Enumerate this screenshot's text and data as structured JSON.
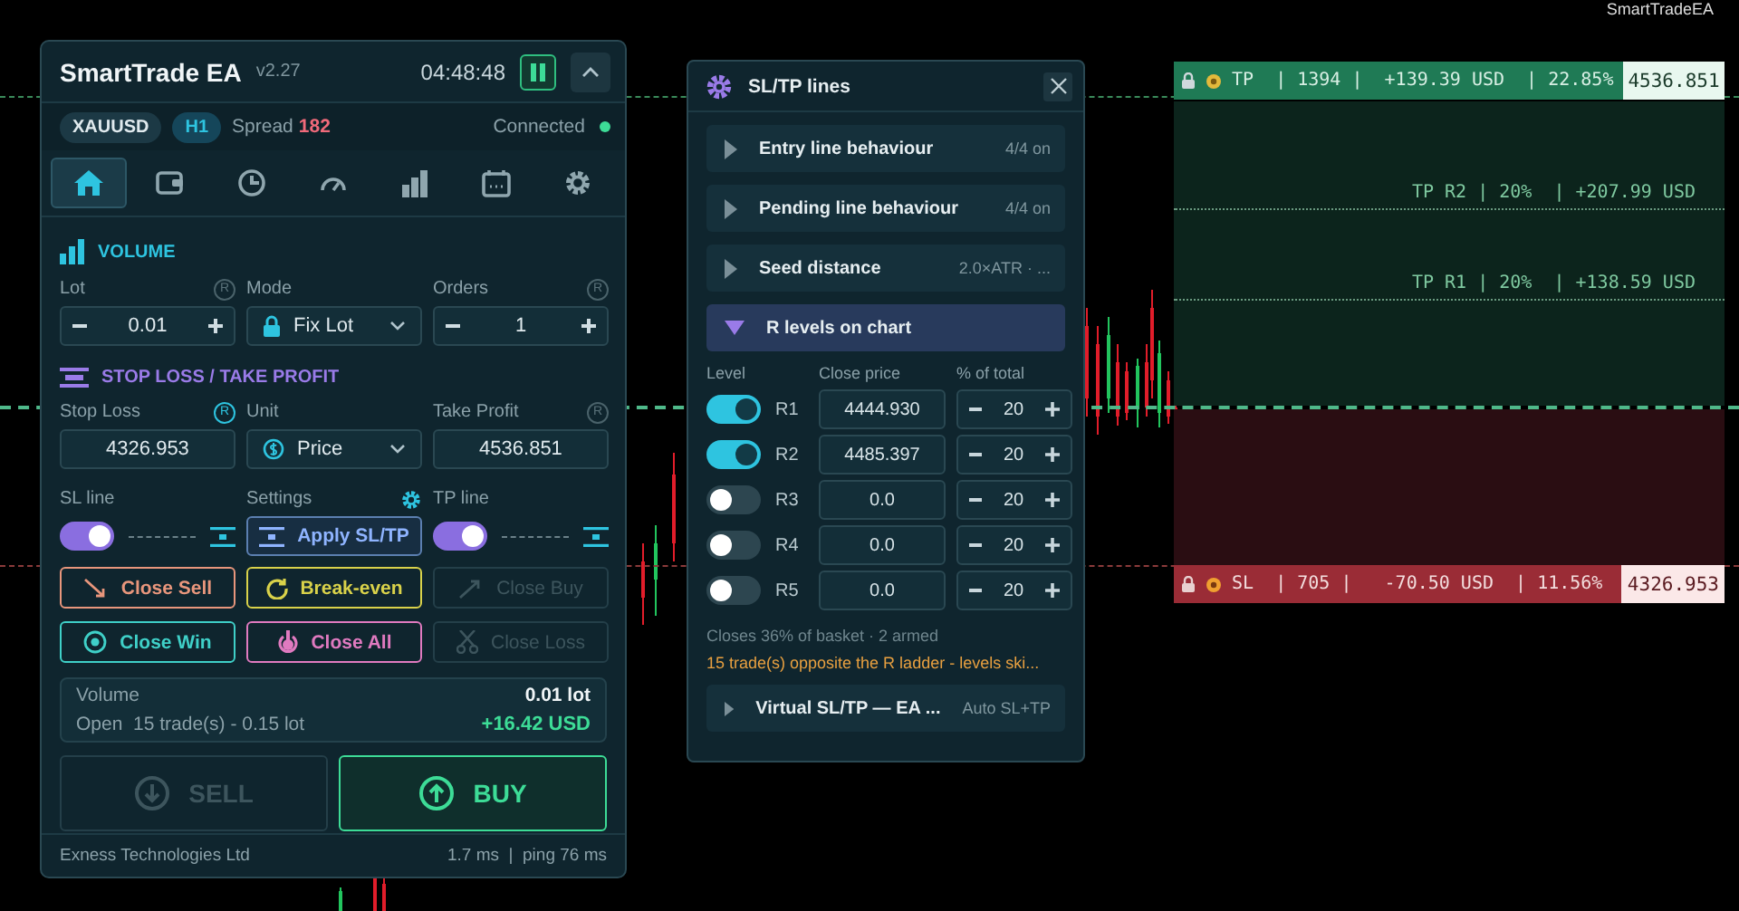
{
  "chart": {
    "corner_label": "SmartTradeEA",
    "tp_tag": {
      "text": "TP  | 1394 |  +139.39 USD  | 22.85%",
      "price": "4536.851"
    },
    "r_levels": [
      {
        "text": "TP R2 | 20%  | +207.99 USD"
      },
      {
        "text": "TP R1 | 20%  | +138.59 USD"
      }
    ],
    "sl_tag": {
      "text": "SL  | 705 |   -70.50 USD  | 11.56%",
      "price": "4326.953"
    }
  },
  "panel": {
    "header": {
      "title": "SmartTrade EA",
      "version": "v2.27",
      "time": "04:48:48"
    },
    "info": {
      "symbol": "XAUUSD",
      "timeframe": "H1",
      "spread_label": "Spread",
      "spread": "182",
      "status": "Connected"
    },
    "tabs": [
      {
        "selected": true
      },
      {
        "selected": false
      },
      {
        "selected": false
      },
      {
        "selected": false
      },
      {
        "selected": false
      },
      {
        "selected": false
      },
      {
        "selected": false
      }
    ],
    "volume": {
      "title": "VOLUME",
      "lot": {
        "label": "Lot",
        "badge": "R",
        "badge_active": false,
        "value": "0.01"
      },
      "mode": {
        "label": "Mode",
        "value": "Fix Lot"
      },
      "orders": {
        "label": "Orders",
        "badge": "R",
        "badge_active": false,
        "value": "1"
      }
    },
    "stops": {
      "title": "STOP LOSS / TAKE PROFIT",
      "stop_loss": {
        "label": "Stop Loss",
        "badge": "R",
        "badge_active": true,
        "value": "4326.953"
      },
      "unit": {
        "label": "Unit",
        "value": "Price"
      },
      "take_profit": {
        "label": "Take Profit",
        "badge": "R",
        "badge_active": false,
        "value": "4536.851"
      }
    },
    "lines": {
      "sl_label": "SL line",
      "sl_on": true,
      "settings_label": "Settings",
      "apply": "Apply SL/TP",
      "tp_label": "TP line",
      "tp_on": true
    },
    "actions": [
      {
        "label": "Close Sell",
        "color": "#e8967c",
        "disabled": false
      },
      {
        "label": "Break-even",
        "color": "#d9d24a",
        "disabled": false
      },
      {
        "label": "Close Buy",
        "disabled": true
      },
      {
        "label": "Close Win",
        "color": "#3fd0c8",
        "disabled": false
      },
      {
        "label": "Close All",
        "color": "#e07ac0",
        "disabled": false
      },
      {
        "label": "Close Loss",
        "disabled": true
      }
    ],
    "summary": {
      "volume_label": "Volume",
      "volume": "0.01 lot",
      "open": "Open  15 trade(s) - 0.15 lot",
      "pnl": "+16.42 USD"
    },
    "trade": [
      {
        "kind": "sell",
        "label": "SELL",
        "disabled": true
      },
      {
        "kind": "buy",
        "label": "BUY",
        "disabled": false
      }
    ],
    "footer": {
      "broker": "Exness Technologies Ltd",
      "latency": "1.7 ms  |  ping 76 ms"
    }
  },
  "dialog": {
    "title": "SL/TP lines",
    "sections": [
      {
        "title": "Entry line behaviour",
        "summary": "4/4 on",
        "expanded": false
      },
      {
        "title": "Pending line behaviour",
        "summary": "4/4 on",
        "expanded": false
      },
      {
        "title": "Seed distance",
        "summary": "2.0×ATR · ...",
        "expanded": false
      },
      {
        "title": "R levels on chart",
        "expanded": true
      },
      {
        "title": "Virtual SL/TP — EA ...",
        "summary": "Auto SL+TP",
        "expanded": false
      }
    ],
    "levels": {
      "columns": [
        "Level",
        "Close price",
        "% of total"
      ],
      "rows": [
        {
          "name": "R1",
          "on": true,
          "price": "4444.930",
          "percent": "20"
        },
        {
          "name": "R2",
          "on": true,
          "price": "4485.397",
          "percent": "20"
        },
        {
          "name": "R3",
          "on": false,
          "price": "0.0",
          "percent": "20"
        },
        {
          "name": "R4",
          "on": false,
          "price": "0.0",
          "percent": "20"
        },
        {
          "name": "R5",
          "on": false,
          "price": "0.0",
          "percent": "20"
        }
      ],
      "note": "Closes 36% of basket · 2 armed",
      "warning": "15 trade(s) opposite the R ladder - levels ski..."
    }
  }
}
